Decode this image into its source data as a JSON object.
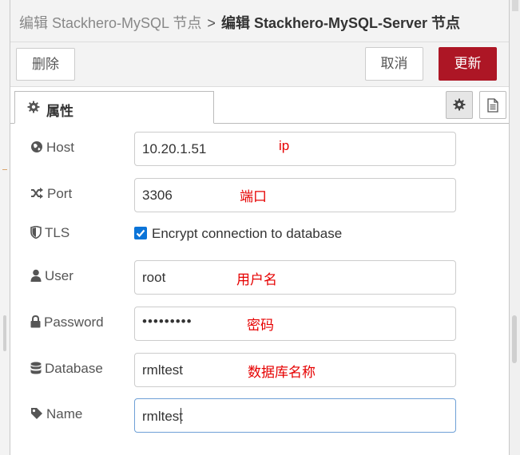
{
  "breadcrumb": {
    "previous": "编辑 Stackhero-MySQL 节点",
    "separator": ">",
    "current": "编辑 Stackhero-MySQL-Server 节点"
  },
  "toolbar": {
    "delete_label": "删除",
    "cancel_label": "取消",
    "update_label": "更新"
  },
  "tabs": {
    "properties_label": "属性"
  },
  "form": {
    "host": {
      "label": "Host",
      "value": "10.20.1.51",
      "note": "ip"
    },
    "port": {
      "label": "Port",
      "value": "3306",
      "note": "端口"
    },
    "tls": {
      "label": "TLS",
      "checkbox_label": "Encrypt connection to database",
      "checked": true
    },
    "user": {
      "label": "User",
      "value": "root",
      "note": "用户名"
    },
    "password": {
      "label": "Password",
      "value": "•••••••••",
      "note": "密码"
    },
    "database": {
      "label": "Database",
      "value": "rmltest",
      "note": "数据库名称"
    },
    "name": {
      "label": "Name",
      "value": "rmltest"
    }
  },
  "colors": {
    "update_button": "#ad1625",
    "checkbox": "#0b74d8",
    "annotation": "#e60000",
    "focus_border": "#6ea0d6"
  },
  "icons": {
    "tab_properties": "gear-icon",
    "tab_settings": "gear-icon",
    "tab_description": "document-icon",
    "host": "globe-icon",
    "port": "shuffle-icon",
    "tls": "shield-icon",
    "user": "user-icon",
    "password": "lock-icon",
    "database": "database-icon",
    "name": "tag-icon"
  }
}
